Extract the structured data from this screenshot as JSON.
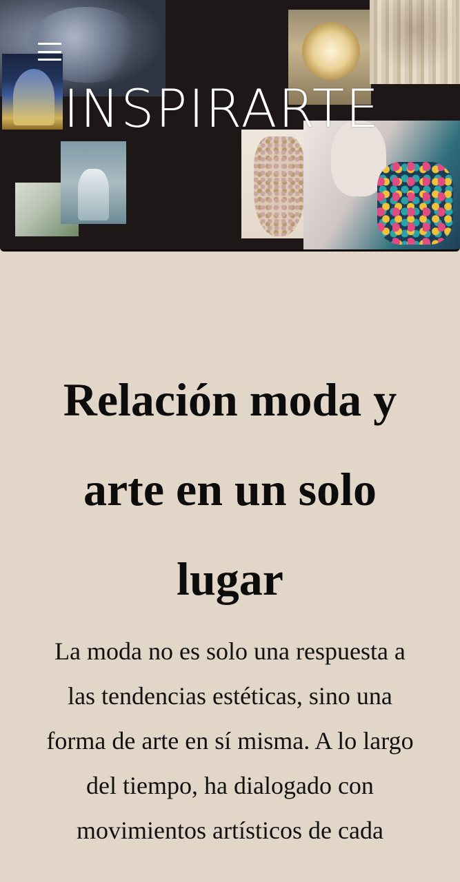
{
  "header": {
    "menu_icon": "hamburger-menu-icon",
    "logo_text": "INSPIRARTE",
    "hero_images": [
      "blue-sculptural-gown-photo",
      "illuminated-ballgown-photo",
      "golden-flower-installation-photo",
      "embroidered-dress-photo",
      "white-feathered-gown-photo",
      "botanical-detail-photo",
      "floral-embellished-dress-photo",
      "jeweled-portrait-photo"
    ]
  },
  "main": {
    "heading": "Relación moda y arte en un solo lugar",
    "intro": "La moda no es solo una respuesta a las tendencias estéticas, sino una forma de arte en sí misma. A lo largo del tiempo, ha dialogado con movimientos artísticos de cada"
  },
  "colors": {
    "page_background": "#e2d6c8",
    "hero_background": "#1e1718",
    "text": "#0c0c0c",
    "logo": "#ffffff"
  }
}
